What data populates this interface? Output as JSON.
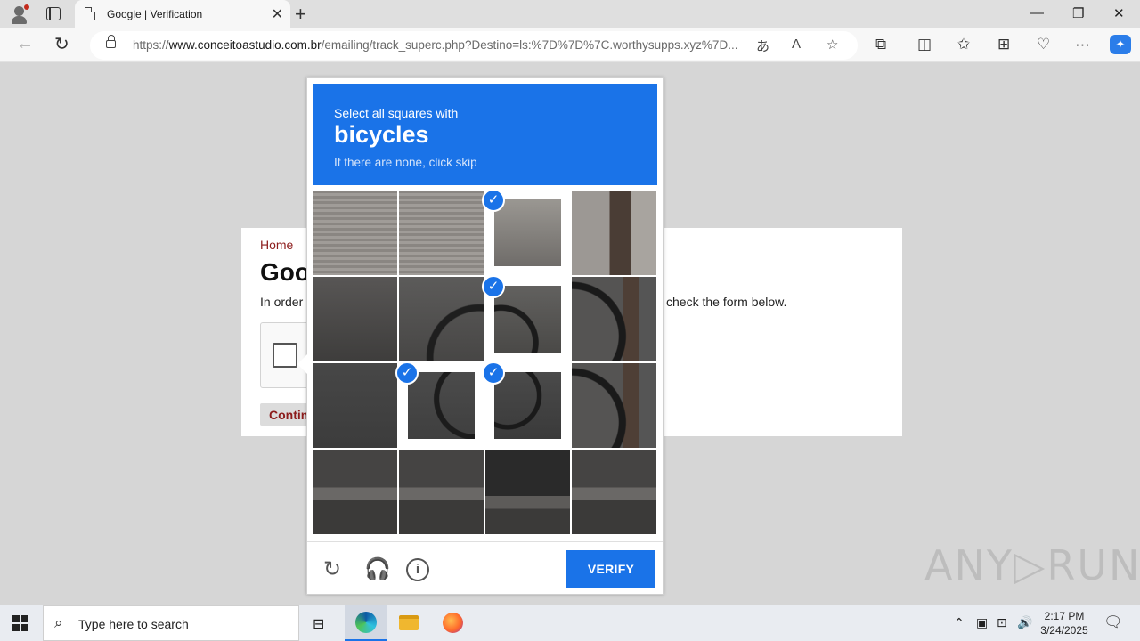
{
  "browser": {
    "tab_title": "Google | Verification",
    "tab_close": "✕",
    "new_tab": "+",
    "url_prefix": "https://",
    "url_host": "www.conceitoastudio.com.br",
    "url_path": "/emailing/track_superc.php?Destino=ls:%7D%7D%7C.worthysupps.xyz%7D..."
  },
  "page": {
    "breadcrumb": "Home",
    "heading": "Goo",
    "intro_start": "In order",
    "intro_end": "check the form below.",
    "continue_label": "Contin"
  },
  "captcha": {
    "instruction": "Select all squares with",
    "target": "bicycles",
    "hint": "If there are none, click skip",
    "verify_label": "VERIFY",
    "check_glyph": "✓",
    "cells": [
      {
        "selected": false,
        "tone": "shutter"
      },
      {
        "selected": false,
        "tone": "shutter"
      },
      {
        "selected": true,
        "tone": "bike-top"
      },
      {
        "selected": false,
        "tone": "pole"
      },
      {
        "selected": false,
        "tone": "wall"
      },
      {
        "selected": false,
        "tone": "wheel-left"
      },
      {
        "selected": true,
        "tone": "bike-mid"
      },
      {
        "selected": false,
        "tone": "wheel-right"
      },
      {
        "selected": false,
        "tone": "street"
      },
      {
        "selected": true,
        "tone": "wheel-low"
      },
      {
        "selected": true,
        "tone": "bike-low"
      },
      {
        "selected": false,
        "tone": "wheel-right"
      },
      {
        "selected": false,
        "tone": "curb"
      },
      {
        "selected": false,
        "tone": "curb"
      },
      {
        "selected": false,
        "tone": "curb-dark"
      },
      {
        "selected": false,
        "tone": "curb"
      }
    ],
    "accent": "#1a73e8"
  },
  "watermark": "ANY▷RUN",
  "taskbar": {
    "search_placeholder": "Type here to search",
    "time": "2:17 PM",
    "date": "3/24/2025"
  }
}
